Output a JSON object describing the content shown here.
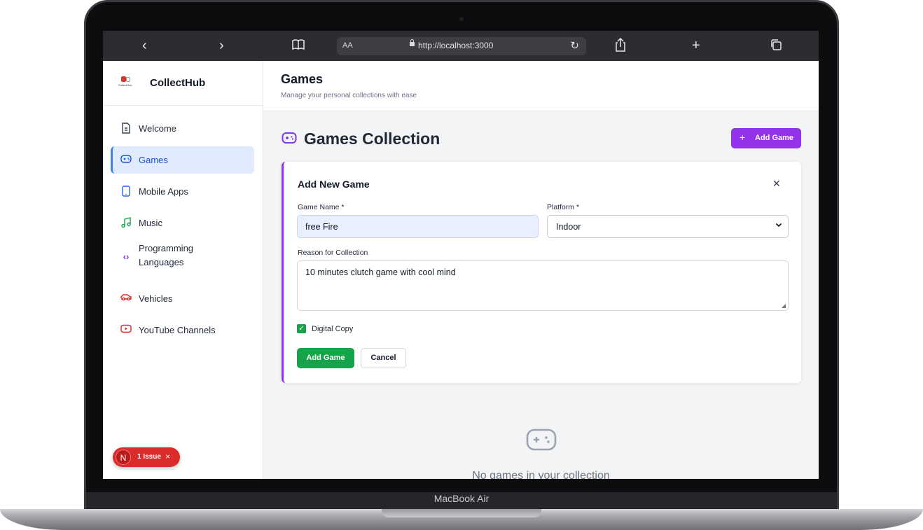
{
  "device": {
    "label": "MacBook Air"
  },
  "browser": {
    "text_size_label": "AA",
    "url": "http://localhost:3000",
    "icons": [
      "back-icon",
      "forward-icon",
      "bookmarks-icon",
      "lock-icon",
      "reload-icon",
      "share-icon",
      "new-tab-icon",
      "tabs-icon"
    ]
  },
  "sidebar": {
    "brand": {
      "name": "CollectHub",
      "logo_text": "CollectHub"
    },
    "items": [
      {
        "label": "Welcome",
        "icon": "document-icon",
        "active": false
      },
      {
        "label": "Games",
        "icon": "gamepad-icon",
        "active": true
      },
      {
        "label": "Mobile Apps",
        "icon": "smartphone-icon",
        "active": false
      },
      {
        "label": "Music",
        "icon": "music-icon",
        "active": false
      },
      {
        "label": "Programming Languages",
        "icon": "code-icon",
        "active": false
      },
      {
        "label": "Vehicles",
        "icon": "car-icon",
        "active": false
      },
      {
        "label": "YouTube Channels",
        "icon": "youtube-icon",
        "active": false
      }
    ],
    "issue_badge": {
      "logo": "N",
      "text": "1 Issue"
    }
  },
  "header": {
    "title": "Games",
    "subtitle": "Manage your personal collections with ease"
  },
  "section": {
    "title": "Games Collection",
    "add_button": "Add Game"
  },
  "form": {
    "title": "Add New Game",
    "name_label": "Game Name *",
    "name_value": "free Fire",
    "platform_label": "Platform *",
    "platform_value": "Indoor",
    "reason_label": "Reason for Collection",
    "reason_value": "10 minutes clutch game with cool mind",
    "digital_copy_label": "Digital Copy",
    "digital_copy_checked": true,
    "submit_label": "Add Game",
    "cancel_label": "Cancel"
  },
  "empty_state": {
    "text": "No games in your collection"
  },
  "colors": {
    "accent_purple": "#9333ea",
    "success_green": "#16a34a",
    "active_blue": "#3b82f6",
    "danger_red": "#dc2b2b"
  }
}
